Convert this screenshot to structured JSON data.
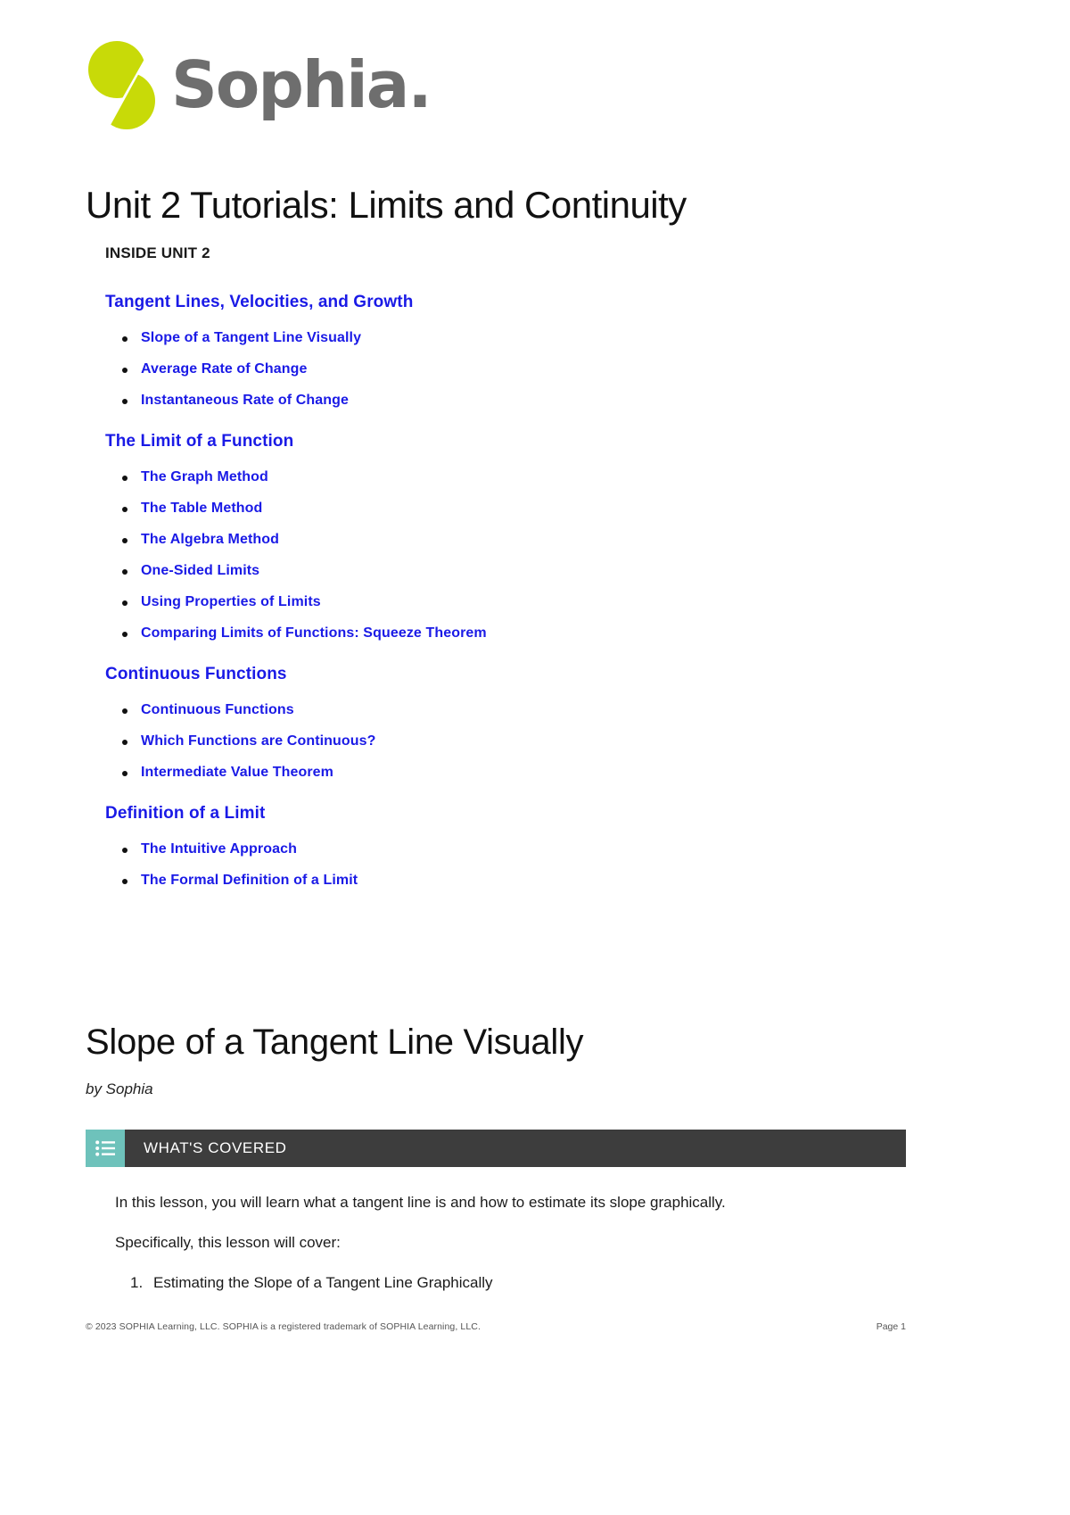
{
  "brand": {
    "name": "Sophia",
    "wordmark": "Sophia",
    "period": ".",
    "logo_icon": "sophia-split-circle-logo",
    "logo_color": "#c8da08",
    "wordmark_color": "#6e6e6e"
  },
  "document": {
    "unit_title": "Unit 2 Tutorials: Limits and Continuity",
    "toc_label": "INSIDE UNIT 2",
    "link_color": "#1a1ae6"
  },
  "toc": {
    "sections": [
      {
        "title": "Tangent Lines, Velocities, and Growth",
        "items": [
          "Slope of a Tangent Line Visually",
          "Average Rate of Change",
          "Instantaneous Rate of Change"
        ]
      },
      {
        "title": "The Limit of a Function",
        "items": [
          "The Graph Method",
          "The Table Method",
          "The Algebra Method",
          "One-Sided Limits",
          "Using Properties of Limits",
          "Comparing Limits of Functions: Squeeze Theorem"
        ]
      },
      {
        "title": "Continuous Functions",
        "items": [
          "Continuous Functions",
          "Which Functions are Continuous?",
          "Intermediate Value Theorem"
        ]
      },
      {
        "title": "Definition of a Limit",
        "items": [
          "The Intuitive Approach",
          "The Formal Definition of a Limit"
        ]
      }
    ]
  },
  "lesson": {
    "title": "Slope of a Tangent Line Visually",
    "byline": "by Sophia"
  },
  "callout": {
    "icon": "list-icon",
    "label": "WHAT'S COVERED",
    "icon_bg": "#6ec2bb",
    "bar_bg": "#3d3d3d"
  },
  "body": {
    "paragraph_1": "In this lesson, you will learn what a tangent line is and how to estimate its slope graphically.",
    "paragraph_2": "Specifically, this lesson will cover:",
    "steps": [
      "Estimating the Slope of a Tangent Line Graphically"
    ]
  },
  "footer": {
    "copyright": "© 2023 SOPHIA Learning, LLC. SOPHIA is a registered trademark of SOPHIA Learning, LLC.",
    "page": "Page 1"
  }
}
